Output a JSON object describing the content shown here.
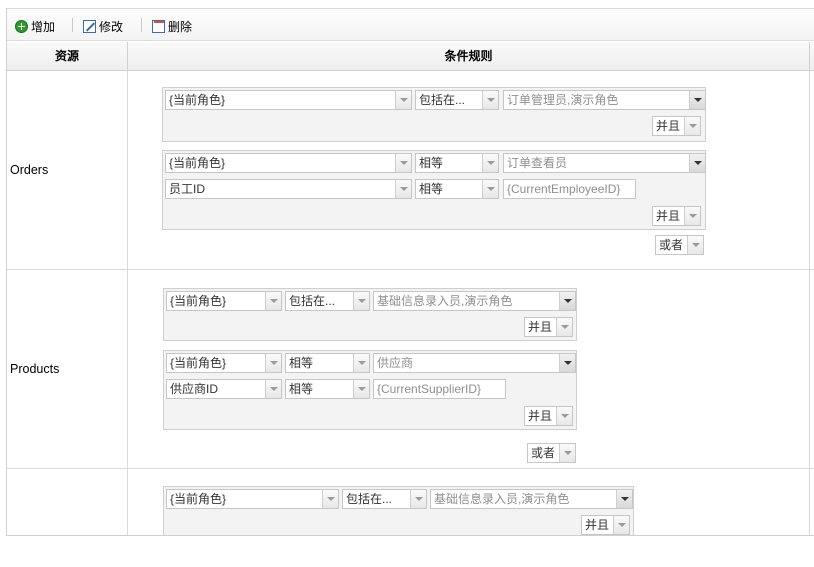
{
  "toolbar": {
    "add": "增加",
    "edit": "修改",
    "delete": "删除"
  },
  "table": {
    "col_resource": "资源",
    "col_rule": "条件规则"
  },
  "rows": [
    {
      "resource": "Orders",
      "groups": [
        {
          "conditions": [
            {
              "field": "{当前角色}",
              "op": "包括在...",
              "value": "订单管理员,演示角色"
            }
          ],
          "connector": "并且"
        },
        {
          "conditions": [
            {
              "field": "{当前角色}",
              "op": "相等",
              "value": "订单查看员"
            },
            {
              "field": "员工ID",
              "op": "相等",
              "value": "{CurrentEmployeeID}"
            }
          ],
          "connector": "并且"
        }
      ],
      "connector": "或者"
    },
    {
      "resource": "Products",
      "groups": [
        {
          "conditions": [
            {
              "field": "{当前角色}",
              "op": "包括在...",
              "value": "基础信息录入员,演示角色"
            }
          ],
          "connector": "并且"
        },
        {
          "conditions": [
            {
              "field": "{当前角色}",
              "op": "相等",
              "value": "供应商"
            },
            {
              "field": "供应商ID",
              "op": "相等",
              "value": "{CurrentSupplierID}"
            }
          ],
          "connector": "并且"
        }
      ],
      "connector": "或者"
    },
    {
      "resource": "",
      "groups": [
        {
          "conditions": [
            {
              "field": "{当前角色}",
              "op": "包括在...",
              "value": "基础信息录入员,演示角色"
            }
          ],
          "connector": "并且"
        }
      ]
    }
  ]
}
